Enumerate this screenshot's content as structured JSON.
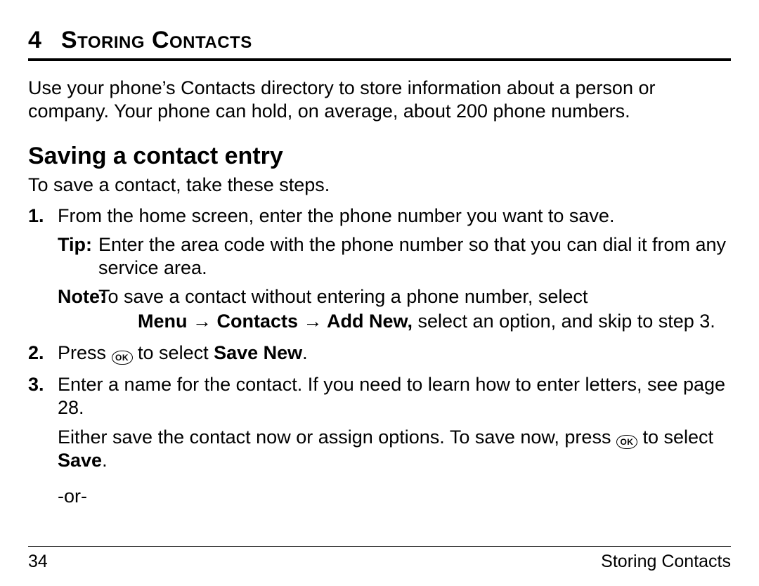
{
  "chapter": {
    "number": "4",
    "title": "Storing Contacts"
  },
  "intro": "Use your phone’s Contacts directory to store information about a person or company. Your phone can hold, on average, about 200 phone numbers.",
  "section": {
    "title": "Saving a contact entry",
    "lead": "To save a contact, take these steps."
  },
  "steps": {
    "s1": {
      "num": "1.",
      "text": "From the home screen, enter the phone number you want to save.",
      "tip_label": "Tip:",
      "tip_body": "Enter the area code with the phone number so that you can dial it from any service area.",
      "note_label": "Note:",
      "note_body_a": "To save a contact without entering a phone number, select",
      "note_menu": "Menu → Contacts → Add New,",
      "note_body_b": " select an option, and skip to step 3."
    },
    "s2": {
      "num": "2.",
      "text_a": "Press ",
      "ok": "OK",
      "text_b": " to select ",
      "save_new": "Save New",
      "period": "."
    },
    "s3": {
      "num": "3.",
      "text": "Enter a name for the contact. If you need to learn how to enter letters, see page 28.",
      "extra_a": "Either save the contact now or assign options. To save now, press ",
      "ok": "OK",
      "extra_b": " to select ",
      "save": "Save",
      "period": ".",
      "or": "-or-"
    }
  },
  "footer": {
    "page": "34",
    "running": "Storing Contacts"
  }
}
